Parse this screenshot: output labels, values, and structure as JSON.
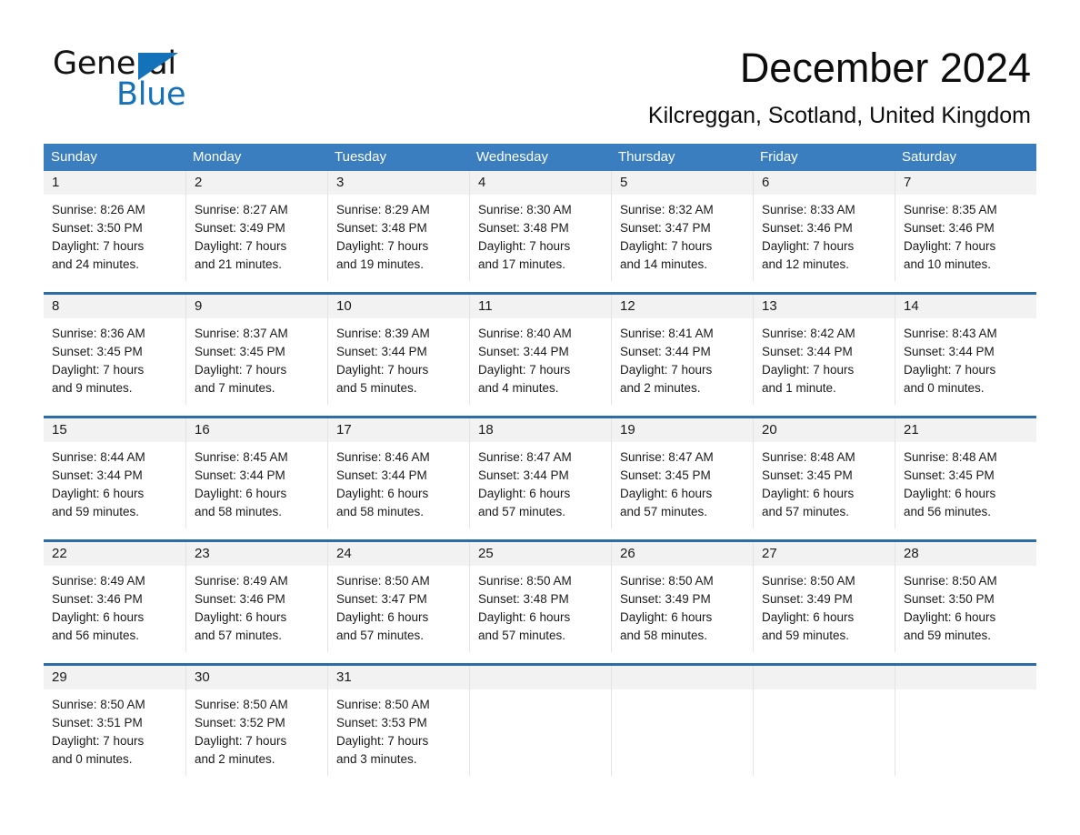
{
  "brand": {
    "name_part1": "General",
    "name_part2": "Blue",
    "accent_color": "#1372ba"
  },
  "header": {
    "title": "December 2024",
    "location": "Kilcreggan, Scotland, United Kingdom"
  },
  "calendar": {
    "header_bg": "#3a7ebf",
    "row_rule_color": "#2c6ca8",
    "daynum_bg": "#f2f2f2",
    "weekdays": [
      "Sunday",
      "Monday",
      "Tuesday",
      "Wednesday",
      "Thursday",
      "Friday",
      "Saturday"
    ],
    "weeks": [
      [
        {
          "day": "1",
          "sunrise": "Sunrise: 8:26 AM",
          "sunset": "Sunset: 3:50 PM",
          "daylight1": "Daylight: 7 hours",
          "daylight2": "and 24 minutes."
        },
        {
          "day": "2",
          "sunrise": "Sunrise: 8:27 AM",
          "sunset": "Sunset: 3:49 PM",
          "daylight1": "Daylight: 7 hours",
          "daylight2": "and 21 minutes."
        },
        {
          "day": "3",
          "sunrise": "Sunrise: 8:29 AM",
          "sunset": "Sunset: 3:48 PM",
          "daylight1": "Daylight: 7 hours",
          "daylight2": "and 19 minutes."
        },
        {
          "day": "4",
          "sunrise": "Sunrise: 8:30 AM",
          "sunset": "Sunset: 3:48 PM",
          "daylight1": "Daylight: 7 hours",
          "daylight2": "and 17 minutes."
        },
        {
          "day": "5",
          "sunrise": "Sunrise: 8:32 AM",
          "sunset": "Sunset: 3:47 PM",
          "daylight1": "Daylight: 7 hours",
          "daylight2": "and 14 minutes."
        },
        {
          "day": "6",
          "sunrise": "Sunrise: 8:33 AM",
          "sunset": "Sunset: 3:46 PM",
          "daylight1": "Daylight: 7 hours",
          "daylight2": "and 12 minutes."
        },
        {
          "day": "7",
          "sunrise": "Sunrise: 8:35 AM",
          "sunset": "Sunset: 3:46 PM",
          "daylight1": "Daylight: 7 hours",
          "daylight2": "and 10 minutes."
        }
      ],
      [
        {
          "day": "8",
          "sunrise": "Sunrise: 8:36 AM",
          "sunset": "Sunset: 3:45 PM",
          "daylight1": "Daylight: 7 hours",
          "daylight2": "and 9 minutes."
        },
        {
          "day": "9",
          "sunrise": "Sunrise: 8:37 AM",
          "sunset": "Sunset: 3:45 PM",
          "daylight1": "Daylight: 7 hours",
          "daylight2": "and 7 minutes."
        },
        {
          "day": "10",
          "sunrise": "Sunrise: 8:39 AM",
          "sunset": "Sunset: 3:44 PM",
          "daylight1": "Daylight: 7 hours",
          "daylight2": "and 5 minutes."
        },
        {
          "day": "11",
          "sunrise": "Sunrise: 8:40 AM",
          "sunset": "Sunset: 3:44 PM",
          "daylight1": "Daylight: 7 hours",
          "daylight2": "and 4 minutes."
        },
        {
          "day": "12",
          "sunrise": "Sunrise: 8:41 AM",
          "sunset": "Sunset: 3:44 PM",
          "daylight1": "Daylight: 7 hours",
          "daylight2": "and 2 minutes."
        },
        {
          "day": "13",
          "sunrise": "Sunrise: 8:42 AM",
          "sunset": "Sunset: 3:44 PM",
          "daylight1": "Daylight: 7 hours",
          "daylight2": "and 1 minute."
        },
        {
          "day": "14",
          "sunrise": "Sunrise: 8:43 AM",
          "sunset": "Sunset: 3:44 PM",
          "daylight1": "Daylight: 7 hours",
          "daylight2": "and 0 minutes."
        }
      ],
      [
        {
          "day": "15",
          "sunrise": "Sunrise: 8:44 AM",
          "sunset": "Sunset: 3:44 PM",
          "daylight1": "Daylight: 6 hours",
          "daylight2": "and 59 minutes."
        },
        {
          "day": "16",
          "sunrise": "Sunrise: 8:45 AM",
          "sunset": "Sunset: 3:44 PM",
          "daylight1": "Daylight: 6 hours",
          "daylight2": "and 58 minutes."
        },
        {
          "day": "17",
          "sunrise": "Sunrise: 8:46 AM",
          "sunset": "Sunset: 3:44 PM",
          "daylight1": "Daylight: 6 hours",
          "daylight2": "and 58 minutes."
        },
        {
          "day": "18",
          "sunrise": "Sunrise: 8:47 AM",
          "sunset": "Sunset: 3:44 PM",
          "daylight1": "Daylight: 6 hours",
          "daylight2": "and 57 minutes."
        },
        {
          "day": "19",
          "sunrise": "Sunrise: 8:47 AM",
          "sunset": "Sunset: 3:45 PM",
          "daylight1": "Daylight: 6 hours",
          "daylight2": "and 57 minutes."
        },
        {
          "day": "20",
          "sunrise": "Sunrise: 8:48 AM",
          "sunset": "Sunset: 3:45 PM",
          "daylight1": "Daylight: 6 hours",
          "daylight2": "and 57 minutes."
        },
        {
          "day": "21",
          "sunrise": "Sunrise: 8:48 AM",
          "sunset": "Sunset: 3:45 PM",
          "daylight1": "Daylight: 6 hours",
          "daylight2": "and 56 minutes."
        }
      ],
      [
        {
          "day": "22",
          "sunrise": "Sunrise: 8:49 AM",
          "sunset": "Sunset: 3:46 PM",
          "daylight1": "Daylight: 6 hours",
          "daylight2": "and 56 minutes."
        },
        {
          "day": "23",
          "sunrise": "Sunrise: 8:49 AM",
          "sunset": "Sunset: 3:46 PM",
          "daylight1": "Daylight: 6 hours",
          "daylight2": "and 57 minutes."
        },
        {
          "day": "24",
          "sunrise": "Sunrise: 8:50 AM",
          "sunset": "Sunset: 3:47 PM",
          "daylight1": "Daylight: 6 hours",
          "daylight2": "and 57 minutes."
        },
        {
          "day": "25",
          "sunrise": "Sunrise: 8:50 AM",
          "sunset": "Sunset: 3:48 PM",
          "daylight1": "Daylight: 6 hours",
          "daylight2": "and 57 minutes."
        },
        {
          "day": "26",
          "sunrise": "Sunrise: 8:50 AM",
          "sunset": "Sunset: 3:49 PM",
          "daylight1": "Daylight: 6 hours",
          "daylight2": "and 58 minutes."
        },
        {
          "day": "27",
          "sunrise": "Sunrise: 8:50 AM",
          "sunset": "Sunset: 3:49 PM",
          "daylight1": "Daylight: 6 hours",
          "daylight2": "and 59 minutes."
        },
        {
          "day": "28",
          "sunrise": "Sunrise: 8:50 AM",
          "sunset": "Sunset: 3:50 PM",
          "daylight1": "Daylight: 6 hours",
          "daylight2": "and 59 minutes."
        }
      ],
      [
        {
          "day": "29",
          "sunrise": "Sunrise: 8:50 AM",
          "sunset": "Sunset: 3:51 PM",
          "daylight1": "Daylight: 7 hours",
          "daylight2": "and 0 minutes."
        },
        {
          "day": "30",
          "sunrise": "Sunrise: 8:50 AM",
          "sunset": "Sunset: 3:52 PM",
          "daylight1": "Daylight: 7 hours",
          "daylight2": "and 2 minutes."
        },
        {
          "day": "31",
          "sunrise": "Sunrise: 8:50 AM",
          "sunset": "Sunset: 3:53 PM",
          "daylight1": "Daylight: 7 hours",
          "daylight2": "and 3 minutes."
        },
        {
          "day": "",
          "sunrise": "",
          "sunset": "",
          "daylight1": "",
          "daylight2": ""
        },
        {
          "day": "",
          "sunrise": "",
          "sunset": "",
          "daylight1": "",
          "daylight2": ""
        },
        {
          "day": "",
          "sunrise": "",
          "sunset": "",
          "daylight1": "",
          "daylight2": ""
        },
        {
          "day": "",
          "sunrise": "",
          "sunset": "",
          "daylight1": "",
          "daylight2": ""
        }
      ]
    ]
  }
}
